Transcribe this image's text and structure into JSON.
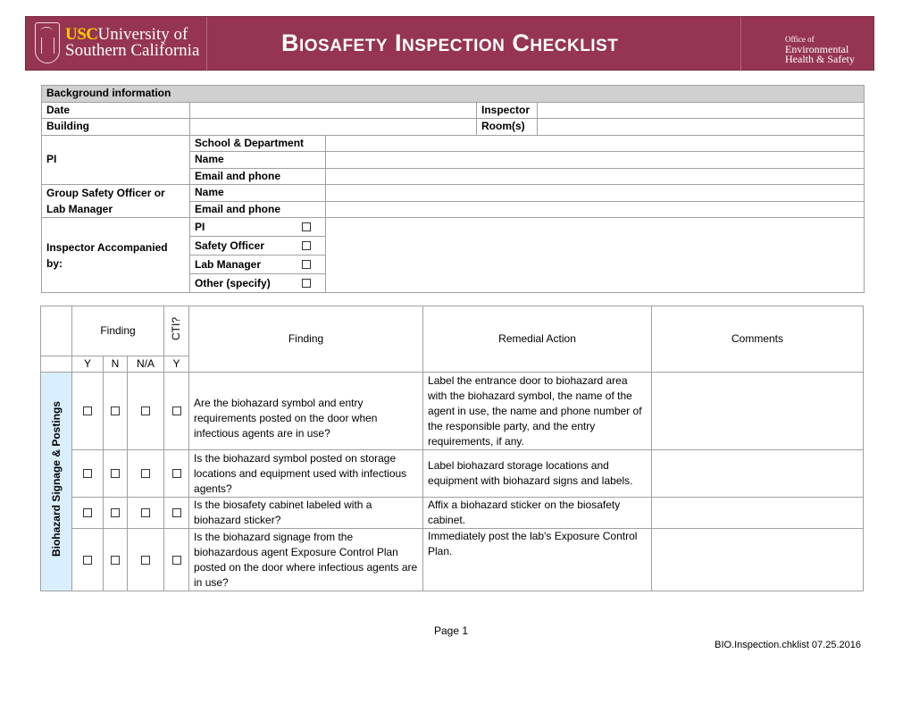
{
  "header": {
    "logo_usc": "USC",
    "logo_line1": "University of",
    "logo_line2": "Southern California",
    "title": "Biosafety Inspection Checklist",
    "office_line1": "Office of",
    "office_line2": "Environmental",
    "office_line3": "Health & Safety",
    "brand_color": "#953551"
  },
  "background": {
    "heading": "Background information",
    "date_label": "Date",
    "date_value": "",
    "inspector_label": "Inspector",
    "inspector_value": "",
    "building_label": "Building",
    "building_value": "",
    "rooms_label": "Room(s)",
    "rooms_value": "",
    "pi_label": "PI",
    "pi_fields": [
      "School & Department",
      "Name",
      "Email and phone"
    ],
    "gso_label": "Group Safety Officer or Lab Manager",
    "gso_fields": [
      "Name",
      "Email and phone"
    ],
    "accompanied_label": "Inspector Accompanied by:",
    "accompanied_options": [
      {
        "label": "PI",
        "checked": false
      },
      {
        "label": "Safety Officer",
        "checked": false
      },
      {
        "label": "Lab Manager",
        "checked": false
      },
      {
        "label": "Other (specify)",
        "checked": false
      }
    ]
  },
  "findings": {
    "headers": {
      "finding_group": "Finding",
      "cti": "CTI?",
      "finding": "Finding",
      "remedial": "Remedial Action",
      "comments": "Comments",
      "y": "Y",
      "n": "N",
      "na": "N/A",
      "cti_y": "Y"
    },
    "category": "Biohazard Signage & Postings",
    "category_color": "#d9efff",
    "rows": [
      {
        "finding": "Are the biohazard symbol and entry requirements posted on the door when infectious agents are in use?",
        "remedial": "Label the entrance door to biohazard area with the biohazard symbol, the name of the agent in use, the name and phone number of the responsible party, and the entry requirements, if any.",
        "comments": ""
      },
      {
        "finding": "Is the biohazard symbol posted on storage locations and equipment used with infectious agents?",
        "remedial": "Label biohazard storage locations and equipment with biohazard signs and labels.",
        "comments": ""
      },
      {
        "finding": "Is the biosafety cabinet labeled with a biohazard sticker?",
        "remedial": "Affix a biohazard sticker on the biosafety cabinet.",
        "comments": ""
      },
      {
        "finding": "Is the biohazard signage from the biohazardous agent Exposure Control Plan posted on the door where infectious agents are in use?",
        "remedial": "Immediately post the lab's Exposure Control Plan.",
        "comments": ""
      }
    ]
  },
  "footer": {
    "page": "Page 1",
    "doc_id": "BIO.Inspection.chklist 07.25.2016"
  }
}
